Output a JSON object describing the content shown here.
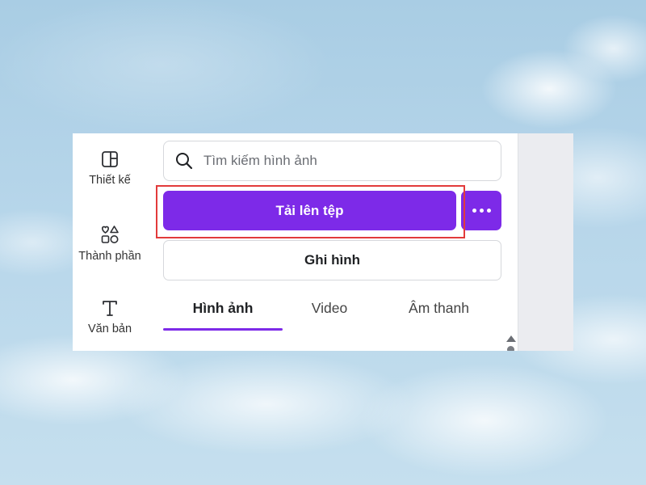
{
  "sidebar": {
    "items": [
      {
        "label": "Thiết kế",
        "icon": "layout-icon"
      },
      {
        "label": "Thành phần",
        "icon": "shapes-icon"
      },
      {
        "label": "Văn bản",
        "icon": "text-icon"
      }
    ]
  },
  "search": {
    "placeholder": "Tìm kiếm hình ảnh",
    "value": ""
  },
  "upload": {
    "label": "Tải lên tệp",
    "more_icon": "more-horizontal-icon"
  },
  "record": {
    "label": "Ghi hình"
  },
  "tabs": [
    {
      "label": "Hình ảnh",
      "active": true
    },
    {
      "label": "Video",
      "active": false
    },
    {
      "label": "Âm thanh",
      "active": false
    }
  ],
  "colors": {
    "accent": "#7d2ae8",
    "highlight_box": "#e23b3b",
    "panel_bg": "#ffffff",
    "canvas_bg": "#ebecf0"
  }
}
